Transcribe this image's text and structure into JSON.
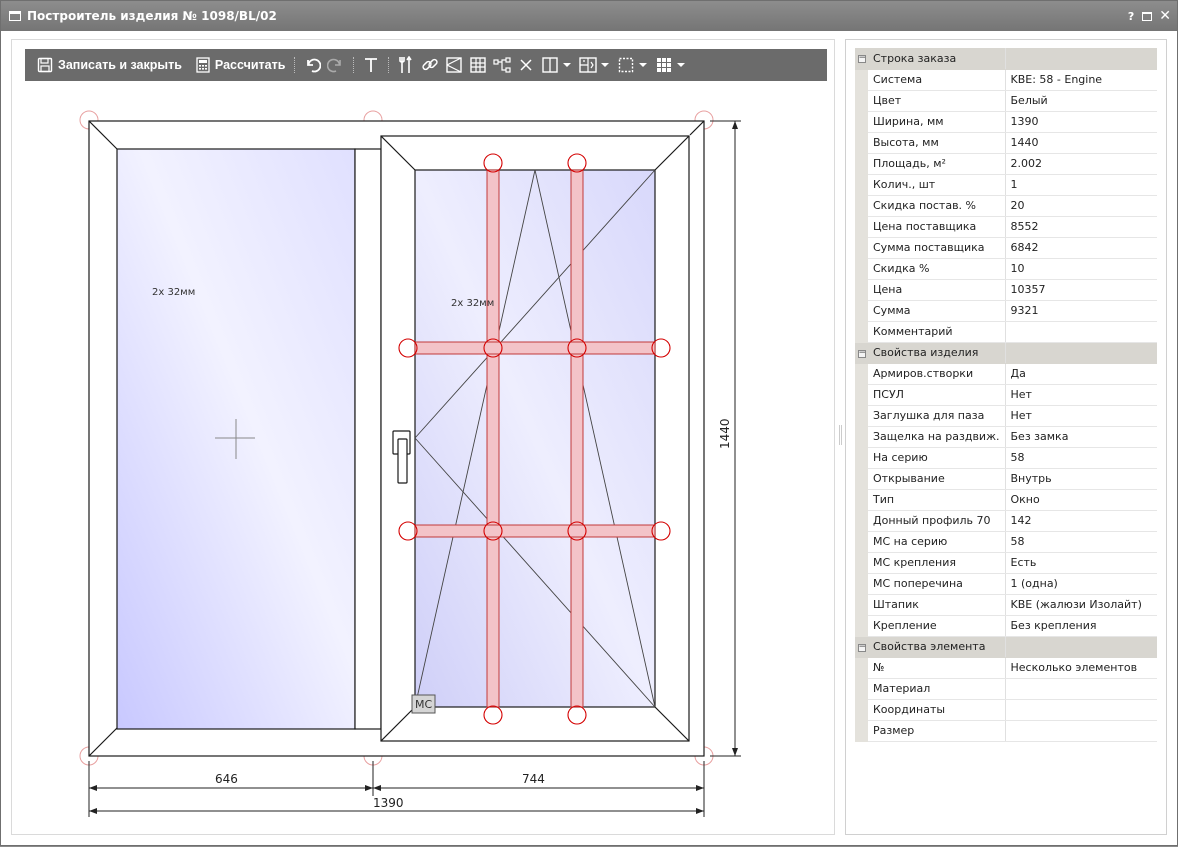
{
  "window": {
    "title": "Построитель изделия № 1098/BL/02",
    "controls": [
      "?",
      "□",
      "✕"
    ]
  },
  "toolbar": {
    "save_close_label": "Записать и закрыть",
    "calculate_label": "Рассчитать",
    "icons": [
      "save-icon",
      "calculator-icon",
      "undo-icon",
      "redo-icon",
      "text-icon",
      "tools-icon",
      "link-icon",
      "sash-icon",
      "grid-icon",
      "connect-icon",
      "delete-icon",
      "split-vertical-icon",
      "split-impost-icon",
      "selection-icon",
      "layout-grid-icon"
    ]
  },
  "drawing": {
    "glass_left_label": "2х 32мм",
    "glass_right_label": "2х 32мм",
    "mc_label": "МС",
    "dim_left": "646",
    "dim_right": "744",
    "dim_total_width": "1390",
    "dim_height": "1440",
    "colors": {
      "frame_stroke": "#1a1a1a",
      "glass": "#dcdcff",
      "muntin_fill": "#f3c3c8",
      "muntin_stroke": "#c23a3a",
      "handle_circle": "#d40000"
    }
  },
  "properties": {
    "groups": [
      {
        "title": "Строка заказа",
        "rows": [
          {
            "name": "Система",
            "value": "KBE: 58 - Engine"
          },
          {
            "name": "Цвет",
            "value": "Белый"
          },
          {
            "name": "Ширина, мм",
            "value": "1390"
          },
          {
            "name": "Высота, мм",
            "value": "1440"
          },
          {
            "name": "Площадь, м²",
            "value": "2.002"
          },
          {
            "name": "Колич., шт",
            "value": "1"
          },
          {
            "name": "Скидка постав. %",
            "value": "20"
          },
          {
            "name": "Цена поставщика",
            "value": "8552"
          },
          {
            "name": "Сумма поставщика",
            "value": "6842"
          },
          {
            "name": "Скидка %",
            "value": "10"
          },
          {
            "name": "Цена",
            "value": "10357"
          },
          {
            "name": "Сумма",
            "value": "9321"
          },
          {
            "name": "Комментарий",
            "value": ""
          }
        ]
      },
      {
        "title": "Свойства изделия",
        "rows": [
          {
            "name": "Армиров.створки",
            "value": "Да"
          },
          {
            "name": "ПСУЛ",
            "value": "Нет"
          },
          {
            "name": "Заглушка для паза",
            "value": "Нет"
          },
          {
            "name": "Защелка на раздвиж.",
            "value": "Без замка"
          },
          {
            "name": "На серию",
            "value": "58"
          },
          {
            "name": "Открывание",
            "value": "Внутрь"
          },
          {
            "name": "Тип",
            "value": "Окно"
          },
          {
            "name": "Донный профиль 70",
            "value": "142"
          },
          {
            "name": "МС на серию",
            "value": "58"
          },
          {
            "name": "МС крепления",
            "value": "Есть"
          },
          {
            "name": "МС поперечина",
            "value": "1 (одна)"
          },
          {
            "name": "Штапик",
            "value": "KBE (жалюзи Изолайт)"
          },
          {
            "name": "Крепление",
            "value": "Без крепления"
          }
        ]
      },
      {
        "title": "Свойства элемента",
        "rows": [
          {
            "name": "№",
            "value": "Несколько элементов"
          },
          {
            "name": "Материал",
            "value": ""
          },
          {
            "name": "Координаты",
            "value": ""
          },
          {
            "name": "Размер",
            "value": ""
          }
        ]
      }
    ]
  }
}
